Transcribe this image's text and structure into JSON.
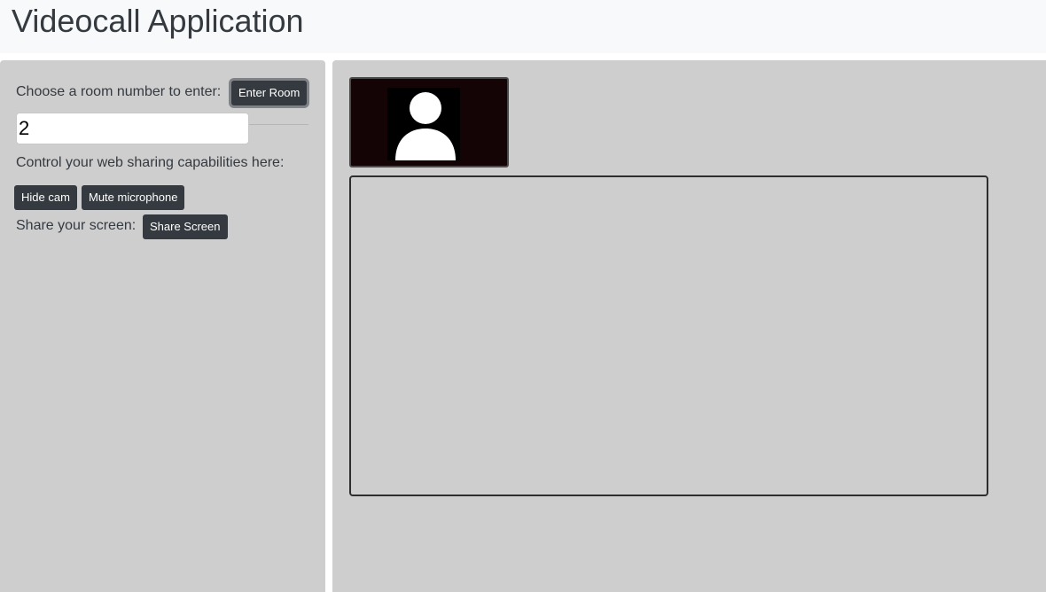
{
  "app": {
    "title": "Videocall Application"
  },
  "room": {
    "prompt": "Choose a room number to enter:",
    "enter_label": "Enter Room",
    "value": "2"
  },
  "controls": {
    "prompt": "Control your web sharing capabilities here:",
    "hide_cam_label": "Hide cam",
    "mute_label": "Mute microphone"
  },
  "share": {
    "prompt": "Share your screen:",
    "button_label": "Share Screen"
  },
  "icons": {
    "local_avatar": "user-silhouette-icon"
  },
  "colors": {
    "header_bg": "#f8f9fa",
    "panel_bg": "#cecece",
    "button_bg": "#343a40",
    "button_text": "#ffffff",
    "video_bg": "#140406"
  }
}
